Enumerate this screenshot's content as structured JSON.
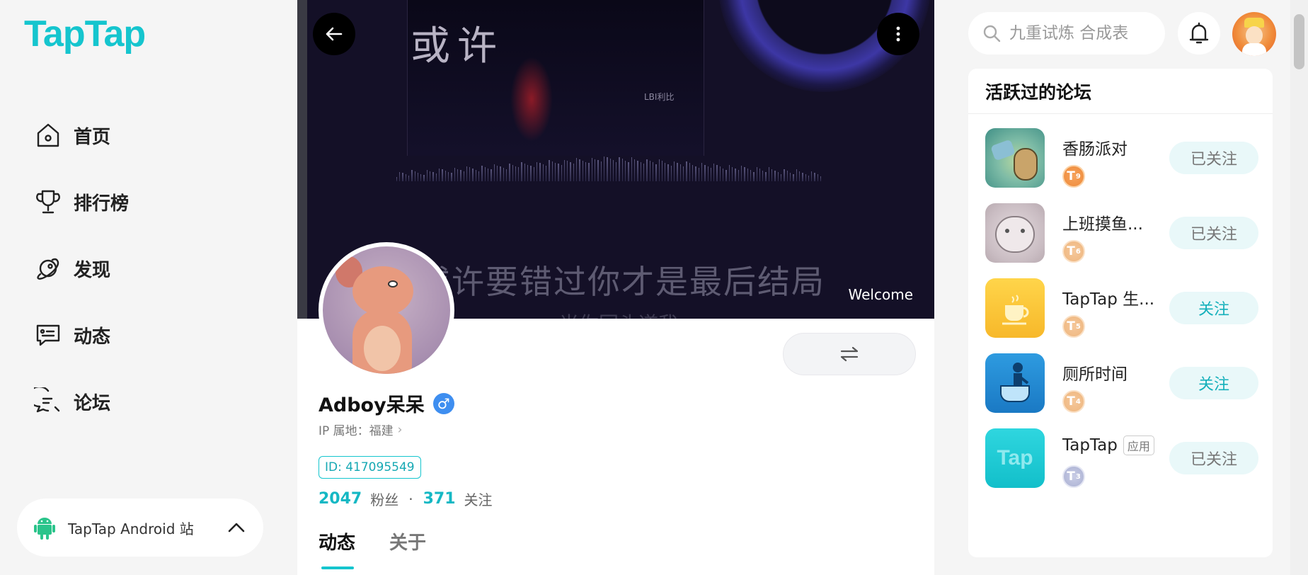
{
  "brand": {
    "logo": "TapTap",
    "accent": "#15c5ce"
  },
  "sidebar": {
    "items": [
      {
        "label": "首页",
        "icon": "home-icon"
      },
      {
        "label": "排行榜",
        "icon": "trophy-icon"
      },
      {
        "label": "发现",
        "icon": "discover-icon"
      },
      {
        "label": "动态",
        "icon": "feed-icon"
      },
      {
        "label": "论坛",
        "icon": "forum-icon"
      }
    ],
    "site_switch": {
      "label": "TapTap Android 站",
      "icon": "android-icon"
    }
  },
  "banner": {
    "album_title": "或许",
    "album_sub": "LBI利比",
    "lyric_main": "或许要错过你才是最后结局",
    "lyric_next": "当你回头道我",
    "welcome": "Welcome"
  },
  "profile": {
    "username": "Adboy呆呆",
    "gender_symbol": "♂",
    "ip_label": "IP 属地：福建",
    "uid": "ID: 417095549",
    "followers_count": "2047",
    "followers_label": "粉丝",
    "following_count": "371",
    "following_label": "关注",
    "tabs": [
      {
        "label": "动态",
        "active": true
      },
      {
        "label": "关于",
        "active": false
      }
    ]
  },
  "header": {
    "search_placeholder": "九重试炼 合成表"
  },
  "forums": {
    "title": "活跃过的论坛",
    "items": [
      {
        "name": "香肠派对",
        "level": "9",
        "level_style": "orange",
        "button": "已关注",
        "followed": true
      },
      {
        "name": "上班摸鱼...",
        "level": "6",
        "level_style": "light",
        "button": "已关注",
        "followed": true
      },
      {
        "name": "TapTap 生...",
        "level": "5",
        "level_style": "light",
        "button": "关注",
        "followed": false
      },
      {
        "name": "厕所时间",
        "level": "4",
        "level_style": "light",
        "button": "关注",
        "followed": false
      },
      {
        "name": "TapTap",
        "tag": "应用",
        "level": "3",
        "level_style": "silver",
        "button": "已关注",
        "followed": true
      }
    ]
  }
}
